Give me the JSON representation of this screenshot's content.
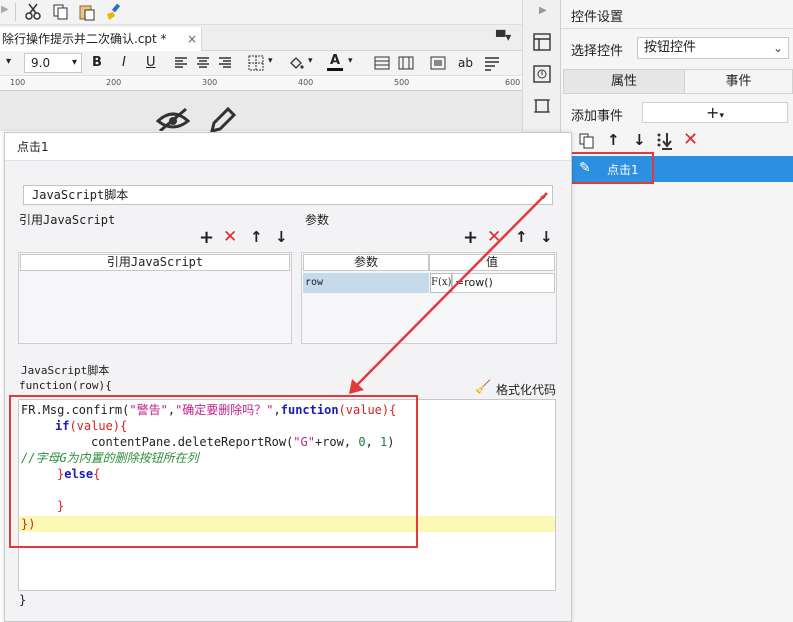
{
  "designer": {
    "file_tab": "除行操作提示并二次确认.cpt *",
    "font_size": "9.0",
    "format_buttons": [
      "B",
      "I",
      "U"
    ],
    "ab_label": "ab",
    "ruler_marks": [
      "100",
      "200",
      "300",
      "400",
      "500",
      "600"
    ]
  },
  "right_panel": {
    "title": "控件设置",
    "select_label": "选择控件",
    "select_value": "按钮控件",
    "tabs": [
      "属性",
      "事件"
    ],
    "add_event_label": "添加事件",
    "event_item": "点击1"
  },
  "dialog": {
    "title": "点击1",
    "script_type": "JavaScript脚本",
    "ref_section_label": "引用JavaScript",
    "ref_col_header": "引用JavaScript",
    "params_section_label": "参数",
    "params_headers": [
      "参数",
      "值"
    ],
    "params_rows": [
      {
        "name": "row",
        "value": "=row()",
        "fx": "F(x)"
      }
    ],
    "script_label": "JavaScript脚本",
    "func_header": "function(row){",
    "format_code": "格式化代码",
    "closing_brace": "}"
  },
  "code": {
    "l1a": "FR.Msg.confirm(",
    "l1b": "\"警告\"",
    "l1c": ",",
    "l1d": "\"确定要删除吗？\"",
    "l1e": ",",
    "l1f": "function",
    "l1g": "(value){",
    "l2a": "if",
    "l2b": "(value){",
    "l3a": "contentPane.deleteReportRow(",
    "l3b": "\"G\"",
    "l3c": "+row, ",
    "l3d": "0",
    "l3e": ", ",
    "l3f": "1",
    "l3g": ")",
    "l4": "//字母G为内置的删除按钮所在列",
    "l5a": "}",
    "l5b": "else",
    "l5c": "{",
    "l7": "}",
    "l8": "})"
  },
  "colors": {
    "selection_blue": "#2d8fe0",
    "param_row_blue": "#c5dbeb",
    "highlight_line": "#fbf9b4",
    "annotation_red": "#e23a3a",
    "delete_red": "#e02828"
  }
}
